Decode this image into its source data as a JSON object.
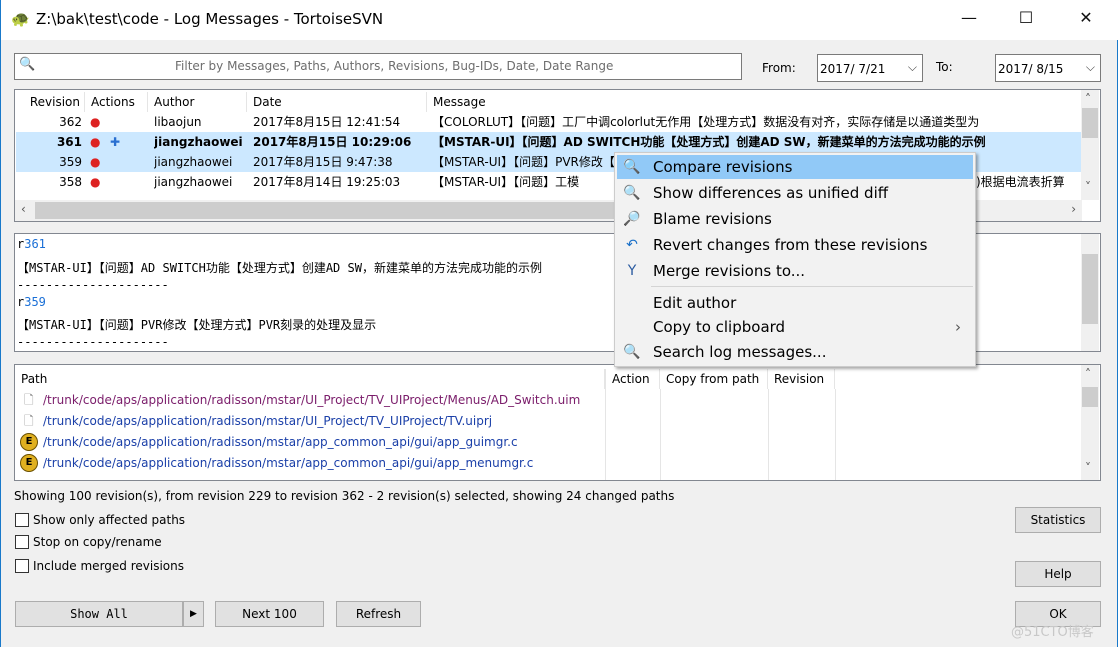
{
  "window": {
    "title": "Z:\\bak\\test\\code - Log Messages - TortoiseSVN",
    "minimize": "—",
    "maximize": "☐",
    "close": "✕"
  },
  "filter": {
    "placeholder": "Filter by Messages, Paths, Authors, Revisions, Bug-IDs, Date, Date Range",
    "from_label": "From:",
    "from_value": "2017/ 7/21",
    "to_label": "To:",
    "to_value": "2017/ 8/15"
  },
  "revisions": {
    "columns": [
      "Revision",
      "Actions",
      "Author",
      "Date",
      "Message"
    ],
    "rows": [
      {
        "revision": "362",
        "author": "libaojun",
        "date": "2017年8月15日 12:41:54",
        "message": "【COLORLUT】【问题】工厂中调colorlut无作用【处理方式】数据没有对齐，实际存储是以通道类型为",
        "selected": false
      },
      {
        "revision": "361",
        "author": "jiangzhaowei",
        "date": "2017年8月15日 10:29:06",
        "message": "【MSTAR-UI】【问题】AD SWITCH功能【处理方式】创建AD SW，新建菜单的方法完成功能的示例",
        "selected": true
      },
      {
        "revision": "359",
        "author": "jiangzhaowei",
        "date": "2017年8月15日 9:47:38",
        "message": "【MSTAR-UI】【问题】PVR修改【处理方式】PVR刻录的处理及显示",
        "selected": true
      },
      {
        "revision": "358",
        "author": "jiangzhaowei",
        "date": "2017年8月14日 19:25:03",
        "message": "【MSTAR-UI】【问题】工模",
        "message_tail": ")根据电流表折算",
        "selected": false
      }
    ]
  },
  "details": {
    "entries": [
      {
        "prefix": "r",
        "rev": "361",
        "text": "【MSTAR-UI】【问题】AD SWITCH功能【处理方式】创建AD SW，新建菜单的方法完成功能的示例"
      },
      {
        "prefix": "r",
        "rev": "359",
        "text": "【MSTAR-UI】【问题】PVR修改【处理方式】PVR刻录的处理及显示"
      }
    ],
    "separator": "---------------------"
  },
  "paths": {
    "columns": [
      "Path",
      "Action",
      "Copy from path",
      "Revision"
    ],
    "rows": [
      {
        "path": "/trunk/code/aps/application/radisson/mstar/UI_Project/TV_UIProject/Menus/AD_Switch.uim",
        "icon": "file-icon"
      },
      {
        "path": "/trunk/code/aps/application/radisson/mstar/UI_Project/TV_UIProject/TV.uiprj",
        "icon": "file-icon"
      },
      {
        "path": "/trunk/code/aps/application/radisson/mstar/app_common_api/gui/app_guimgr.c",
        "icon": "ultraedit-icon"
      },
      {
        "path": "/trunk/code/aps/application/radisson/mstar/app_common_api/gui/app_menumgr.c",
        "icon": "ultraedit-icon"
      }
    ]
  },
  "status": "Showing 100 revision(s), from revision 229 to revision 362 - 2 revision(s) selected, showing 24 changed paths",
  "options": [
    "Show only affected paths",
    "Stop on copy/rename",
    "Include merged revisions"
  ],
  "buttons": {
    "show_all": "Show All",
    "next": "Next 100",
    "refresh": "Refresh",
    "statistics": "Statistics",
    "help": "Help",
    "ok": "OK"
  },
  "context_menu": {
    "items": [
      {
        "label": "Compare revisions",
        "icon": "compare-icon",
        "highlighted": true
      },
      {
        "label": "Show differences as unified diff",
        "icon": "diff-icon"
      },
      {
        "label": "Blame revisions",
        "icon": "blame-icon"
      },
      {
        "label": "Revert changes from these revisions",
        "icon": "revert-icon"
      },
      {
        "label": "Merge revisions to...",
        "icon": "merge-icon"
      },
      {
        "label": "Edit author"
      },
      {
        "label": "Copy to clipboard",
        "submenu": true
      },
      {
        "label": "Search log messages...",
        "icon": "search-icon"
      }
    ]
  },
  "watermark": "@51CTO博客",
  "colors": {
    "selection": "#cce8ff",
    "menu_highlight": "#91c9f7",
    "link": "#1a6fd6"
  }
}
